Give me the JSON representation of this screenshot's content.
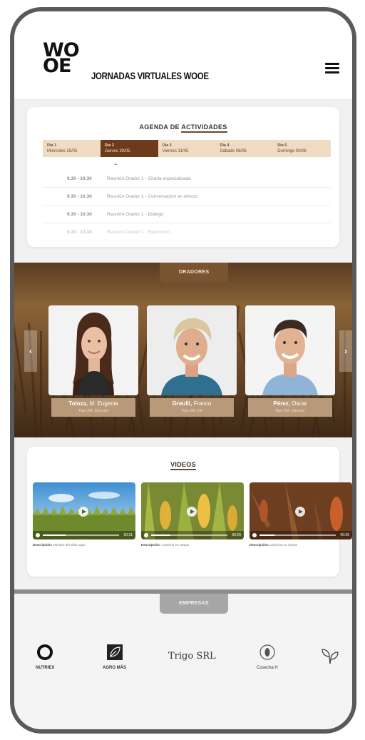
{
  "header": {
    "logo_line1": "WO",
    "logo_line2": "OE",
    "title": "JORNADAS VIRTUALES WOOE",
    "menu_icon": "hamburger-menu-icon"
  },
  "agenda": {
    "title_prefix": "AGENDA DE ",
    "title_underlined": "ACTIVIDADES",
    "tabs": [
      {
        "day": "Día 1",
        "date": "Miércoles 25/05"
      },
      {
        "day": "Día 2",
        "date": "Jueves 30/05"
      },
      {
        "day": "Día 3",
        "date": "Viernes 31/05"
      },
      {
        "day": "Día 4",
        "date": "Sábado 06/06"
      },
      {
        "day": "Día 5",
        "date": "Domingo 00/06"
      }
    ],
    "active_tab": 1,
    "rows": [
      {
        "time": "9.30 - 10.30",
        "activity": "Reunión Orador 1 - Charla especializada"
      },
      {
        "time": "9.30 - 10.30",
        "activity": "Reunión Orador 1 - Conversación en directo"
      },
      {
        "time": "9.30 - 10.30",
        "activity": "Reunión Orador 1 - Diálogo"
      },
      {
        "time": "9.30 - 10.30",
        "activity": "Reunión Orador 1 - Exposición"
      }
    ]
  },
  "speakers": {
    "title": "ORADORES",
    "prev": "‹",
    "next": "›",
    "items": [
      {
        "surname": "Toloza,",
        "name": "M. Eugenia",
        "role": "Tipo 2M. Director"
      },
      {
        "surname": "Greulli,",
        "name": "Franco",
        "role": "Tipo 2M. Dir"
      },
      {
        "surname": "Pérez,",
        "name": "Oscar",
        "role": "Tipo 2M. Director"
      }
    ]
  },
  "videos": {
    "title": "VIDEOS",
    "items": [
      {
        "caption_bold": "Descripción:",
        "caption": "Nombre del video aquí",
        "time": "00:31",
        "progress": 0.3
      },
      {
        "caption_bold": "Descripción:",
        "caption": "Cosecha en campo",
        "time": "00:26",
        "progress": 0.25
      },
      {
        "caption_bold": "Descripción:",
        "caption": "Cosecha en campo",
        "time": "00:25",
        "progress": 0.2
      }
    ]
  },
  "sponsors": {
    "title": "EMPRESAS",
    "items": [
      {
        "name": "NUTRIEX",
        "icon": "ring-logo-icon"
      },
      {
        "name": "AGRO MÁS",
        "icon": "leaf-square-logo-icon"
      },
      {
        "name": "Trigo SRL",
        "icon": "text-logo"
      },
      {
        "name": "Cosecha H",
        "icon": "seed-circle-logo-icon"
      },
      {
        "name": "",
        "icon": "leaves-logo-icon"
      }
    ]
  }
}
